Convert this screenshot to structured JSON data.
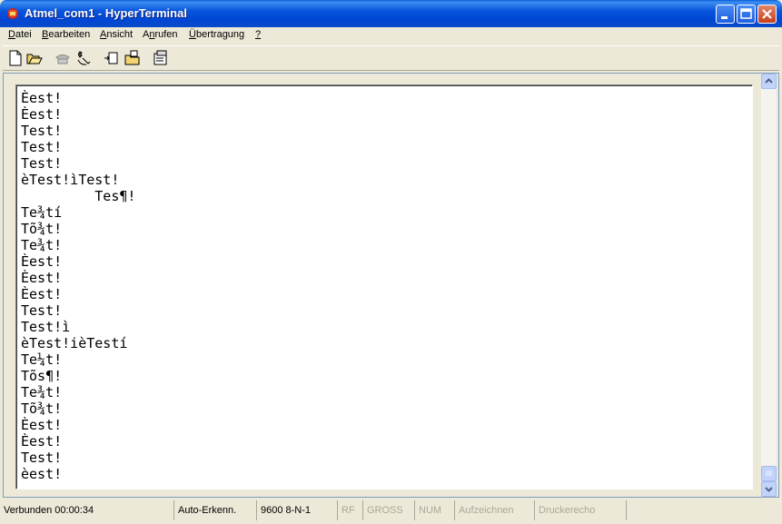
{
  "window": {
    "title": "Atmel_com1 - HyperTerminal"
  },
  "menu": {
    "items": [
      {
        "first": "D",
        "rest": "atei"
      },
      {
        "first": "B",
        "rest": "earbeiten"
      },
      {
        "first": "A",
        "rest": "nsicht"
      },
      {
        "pre": "A",
        "first": "n",
        "rest": "rufen"
      },
      {
        "first": "Ü",
        "rest": "bertragung"
      },
      {
        "first": "?",
        "rest": ""
      }
    ]
  },
  "toolbar": {
    "icons": [
      "new-file-icon",
      "open-folder-icon",
      "connect-phone-icon",
      "disconnect-phone-icon",
      "send-file-icon",
      "receive-file-icon",
      "properties-icon"
    ]
  },
  "terminal": {
    "lines": [
      "Èest!",
      "Èest!",
      "Test!",
      "Test!",
      "Test!",
      "èTest!ìTest!",
      "         Tes¶!",
      "Te¾tí",
      "Tõ¾t!",
      "Te¾t!",
      "Èest!",
      "Èest!",
      "Èest!",
      "Test!",
      "Test!ì",
      "èTest!ièTestí",
      "Te¼t!",
      "Tõs¶!",
      "Te¾t!",
      "Tõ¾t!",
      "Èest!",
      "Èest!",
      "Test!",
      "èest!"
    ]
  },
  "status": {
    "connection": "Verbunden 00:00:34",
    "detect": "Auto-Erkenn.",
    "settings": "9600 8-N-1",
    "rf": "RF",
    "gross": "GROSS",
    "num": "NUM",
    "capture": "Aufzeichnen",
    "echo": "Druckerecho"
  }
}
